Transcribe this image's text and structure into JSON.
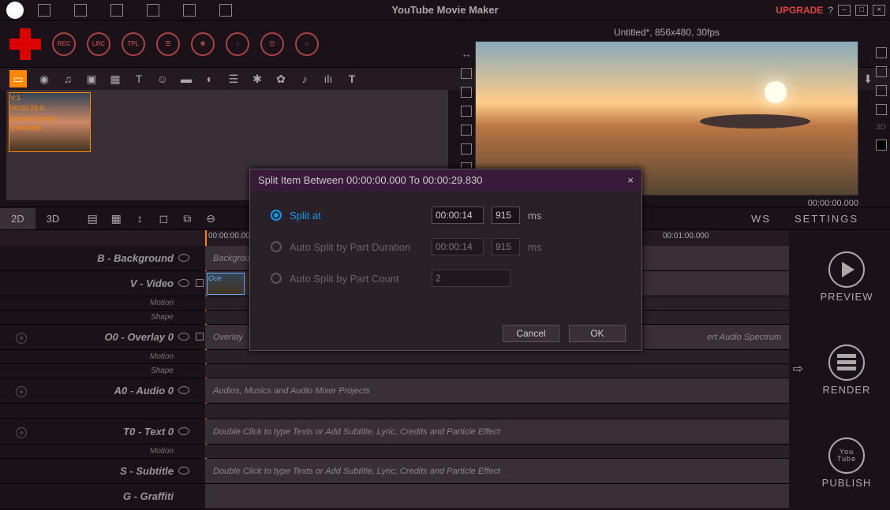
{
  "app": {
    "title": "YouTube Movie Maker",
    "upgrade": "UPGRADE",
    "help": "?"
  },
  "toolbar_circles": [
    "REC",
    "LRC",
    "TPL"
  ],
  "media": {
    "clip_id": "V:1",
    "clip_dur": "00:00:29.0",
    "clip_name_1": "Ocean Sunset",
    "clip_name_2": "View.mp4"
  },
  "preview": {
    "title": "Untitled*, 856x480, 30fps",
    "time": "00:00:00.000"
  },
  "tabs": {
    "t2d": "2D",
    "t3d": "3D",
    "ws": "WS",
    "settings": "SETTINGS"
  },
  "ruler": {
    "t0": "00:00:00.000",
    "t1": "00:01:00.000"
  },
  "tracks": {
    "bg": {
      "label": "B - Background",
      "hint": "Backgrou"
    },
    "vid": {
      "label": "V - Video",
      "sub1": "Motion",
      "sub2": "Shape",
      "clip": "Oce"
    },
    "ov": {
      "label": "O0 - Overlay 0",
      "sub1": "Motion",
      "sub2": "Shape",
      "hint": "Overlay",
      "right": "ert Audio Spectrum"
    },
    "au": {
      "label": "A0 - Audio 0",
      "hint": "Audios, Musics and Audio Mixer Projects"
    },
    "tx": {
      "label": "T0 - Text 0",
      "sub1": "Motion",
      "hint": "Double Click to type Texts or Add Subtitle, Lyric, Credits and Particle Effect"
    },
    "st": {
      "label": "S - Subtitle",
      "hint": "Double Click to type Texts or Add Subtitle, Lyric, Credits and Particle Effect"
    },
    "gf": {
      "label": "G - Graffiti"
    }
  },
  "actions": {
    "preview": "PREVIEW",
    "render": "RENDER",
    "publish": "PUBLISH",
    "yt1": "You",
    "yt2": "Tube"
  },
  "dialog": {
    "title": "Split Item Between 00:00:00.000 To 00:00:29.830",
    "opt1": "Split at",
    "opt2": "Auto Split by Part Duration",
    "opt3": "Auto Split by Part Count",
    "time1": "00:00:14",
    "ms1": "915",
    "time2": "00:00:14",
    "ms2": "915",
    "count": "2",
    "unit": "ms",
    "cancel": "Cancel",
    "ok": "OK"
  }
}
